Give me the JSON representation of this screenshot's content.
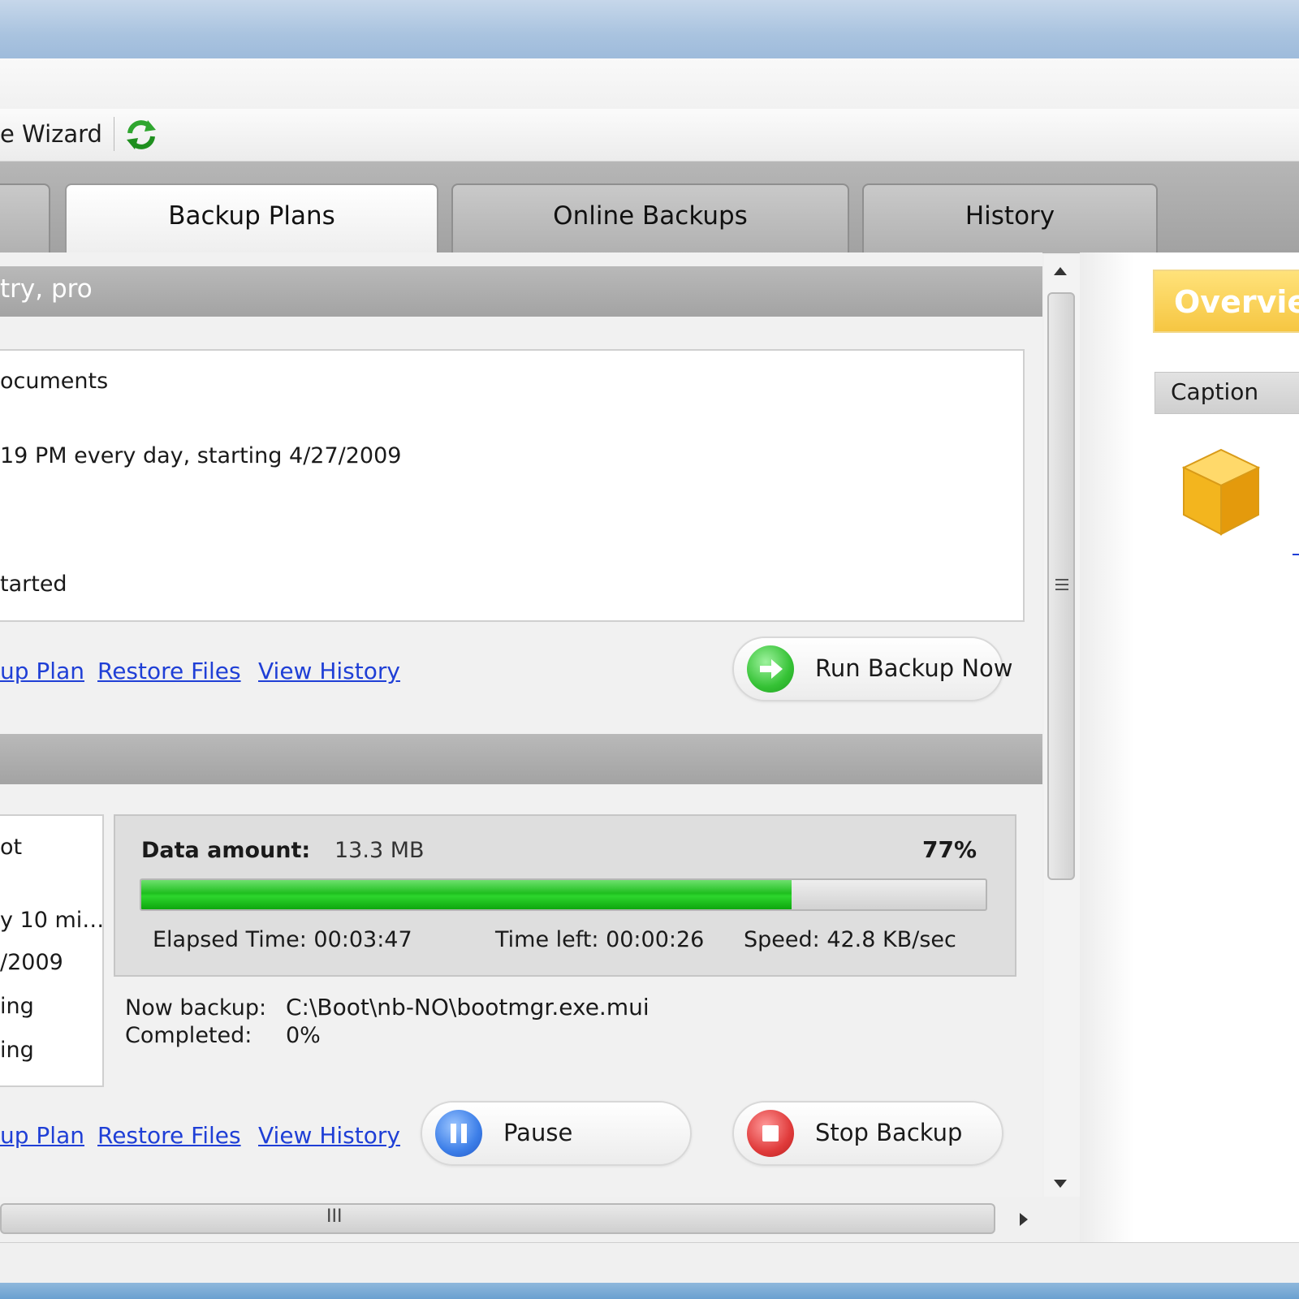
{
  "toolbar": {
    "wizard_label": "e Wizard"
  },
  "tabs": [
    {
      "label": "Backup Plans",
      "active": true
    },
    {
      "label": "Online Backups",
      "active": false
    },
    {
      "label": "History",
      "active": false
    }
  ],
  "plan1": {
    "header": "try, pro",
    "lines": [
      "ocuments",
      "19 PM every day, starting 4/27/2009",
      "tarted"
    ],
    "links": {
      "edit": "up Plan",
      "restore": "Restore Files",
      "history": "View History"
    },
    "run_button": "Run Backup Now"
  },
  "plan2": {
    "lines": [
      "ot",
      "y 10 mi…",
      "/2009",
      "ing",
      "ing"
    ],
    "data_amount_label": "Data amount:",
    "data_amount_value": "13.3 MB",
    "percent_label": "77%",
    "progress": 0.77,
    "elapsed": "Elapsed Time: 00:03:47",
    "time_left": "Time left: 00:00:26",
    "speed": "Speed: 42.8 KB/sec",
    "now_backup_label": "Now backup:",
    "now_backup_value": "C:\\Boot\\nb-NO\\bootmgr.exe.mui",
    "completed_label": "Completed:",
    "completed_value": "0%",
    "links": {
      "edit": "up Plan",
      "restore": "Restore Files",
      "history": "View History"
    },
    "pause_button": "Pause",
    "stop_button": "Stop Backup"
  },
  "right": {
    "overview": "Overvie",
    "caption": "Caption"
  },
  "scroll": {
    "h_grip": "III"
  },
  "colors": {
    "link": "#1f3fd6",
    "progress": "#1fbf1f",
    "overview": "#f6c642"
  },
  "icons": [
    "sync-icon",
    "run-arrow-icon",
    "pause-icon",
    "stop-icon",
    "box-icon",
    "scroll-up-icon",
    "scroll-down-icon",
    "scroll-right-icon"
  ]
}
